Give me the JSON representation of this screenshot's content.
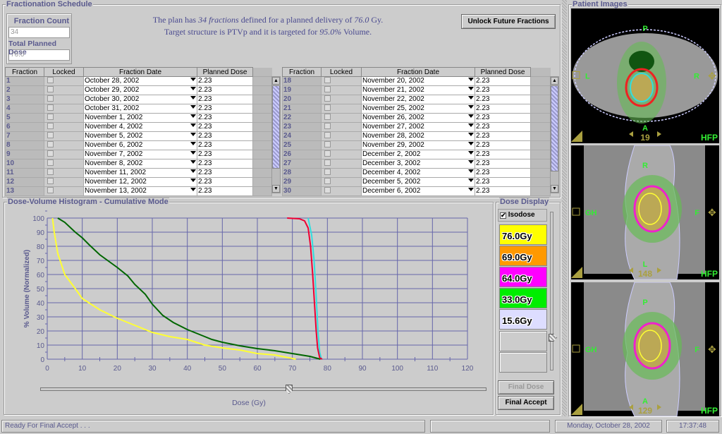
{
  "fractionation": {
    "title": "Fractionation Schedule",
    "fraction_count_label": "Fraction Count",
    "fraction_count_value": "34",
    "total_dose_label": "Total Planned Dose",
    "total_dose_value": "76.0",
    "message": {
      "l1a": "The plan has ",
      "l1b": "34 fractions",
      "l1c": " defined for a planned delivery of ",
      "l1d": "76.0",
      "l1e": " Gy.",
      "l2a": "Target structure is PTVp and it is targeted for ",
      "l2b": "95.0%",
      "l2c": " Volume."
    },
    "unlock_button": "Unlock Future Fractions",
    "columns": [
      "Fraction",
      "Locked",
      "Fraction Date",
      "Planned Dose"
    ],
    "left_rows": [
      [
        "1",
        "October 28, 2002",
        "2.23"
      ],
      [
        "2",
        "October 29, 2002",
        "2.23"
      ],
      [
        "3",
        "October 30, 2002",
        "2.23"
      ],
      [
        "4",
        "October 31, 2002",
        "2.23"
      ],
      [
        "5",
        "November 1, 2002",
        "2.23"
      ],
      [
        "6",
        "November 4, 2002",
        "2.23"
      ],
      [
        "7",
        "November 5, 2002",
        "2.23"
      ],
      [
        "8",
        "November 6, 2002",
        "2.23"
      ],
      [
        "9",
        "November 7, 2002",
        "2.23"
      ],
      [
        "10",
        "November 8, 2002",
        "2.23"
      ],
      [
        "11",
        "November 11, 2002",
        "2.23"
      ],
      [
        "12",
        "November 12, 2002",
        "2.23"
      ],
      [
        "13",
        "November 13, 2002",
        "2.23"
      ]
    ],
    "right_rows": [
      [
        "18",
        "November 20, 2002",
        "2.23"
      ],
      [
        "19",
        "November 21, 2002",
        "2.23"
      ],
      [
        "20",
        "November 22, 2002",
        "2.23"
      ],
      [
        "21",
        "November 25, 2002",
        "2.23"
      ],
      [
        "22",
        "November 26, 2002",
        "2.23"
      ],
      [
        "23",
        "November 27, 2002",
        "2.23"
      ],
      [
        "24",
        "November 28, 2002",
        "2.23"
      ],
      [
        "25",
        "November 29, 2002",
        "2.23"
      ],
      [
        "26",
        "December 2, 2002",
        "2.23"
      ],
      [
        "27",
        "December 3, 2002",
        "2.23"
      ],
      [
        "28",
        "December 4, 2002",
        "2.23"
      ],
      [
        "29",
        "December 5, 2002",
        "2.23"
      ],
      [
        "30",
        "December 6, 2002",
        "2.23"
      ]
    ]
  },
  "dvh": {
    "title": "Dose-Volume Histogram - Cumulative Mode"
  },
  "chart_data": {
    "type": "line",
    "xlabel": "Dose (Gy)",
    "ylabel": "% Volume (Normalized)",
    "xlim": [
      0,
      120
    ],
    "ylim": [
      0,
      100
    ],
    "xticks": [
      0,
      10,
      20,
      30,
      40,
      50,
      60,
      70,
      80,
      90,
      100,
      110,
      120
    ],
    "yticks": [
      0,
      10,
      20,
      30,
      40,
      50,
      60,
      70,
      80,
      90,
      100
    ],
    "grid": true,
    "series": [
      {
        "color": "#ffff33",
        "points": [
          [
            1.5,
            100
          ],
          [
            2,
            90
          ],
          [
            3,
            75
          ],
          [
            5,
            60
          ],
          [
            8,
            50
          ],
          [
            10,
            43
          ],
          [
            15,
            35
          ],
          [
            20,
            29
          ],
          [
            25,
            24
          ],
          [
            30,
            19
          ],
          [
            35,
            16
          ],
          [
            40,
            14
          ],
          [
            45,
            10
          ],
          [
            50,
            8
          ],
          [
            55,
            6.5
          ],
          [
            60,
            4
          ],
          [
            65,
            3
          ],
          [
            68,
            1.5
          ],
          [
            71,
            0
          ]
        ]
      },
      {
        "color": "#006600",
        "points": [
          [
            3,
            100
          ],
          [
            5,
            97
          ],
          [
            8,
            90
          ],
          [
            10,
            86
          ],
          [
            12,
            81
          ],
          [
            15,
            74
          ],
          [
            20,
            65
          ],
          [
            23,
            59
          ],
          [
            25,
            53
          ],
          [
            28,
            46
          ],
          [
            30,
            39
          ],
          [
            33,
            31
          ],
          [
            36,
            26
          ],
          [
            40,
            21
          ],
          [
            45,
            16
          ],
          [
            47,
            14
          ],
          [
            50,
            12
          ],
          [
            55,
            9.5
          ],
          [
            60,
            7.5
          ],
          [
            65,
            6
          ],
          [
            70,
            4
          ],
          [
            75,
            2
          ],
          [
            78,
            0
          ]
        ]
      },
      {
        "color": "#33dddd",
        "points": [
          [
            74.5,
            100
          ],
          [
            75.5,
            88
          ],
          [
            76.2,
            70
          ],
          [
            76.8,
            45
          ],
          [
            77.3,
            20
          ],
          [
            77.8,
            5
          ],
          [
            78.3,
            0
          ]
        ]
      },
      {
        "color": "#ee0033",
        "points": [
          [
            68.5,
            100
          ],
          [
            72,
            99.5
          ],
          [
            73.5,
            98
          ],
          [
            74.5,
            93
          ],
          [
            75.2,
            80
          ],
          [
            75.8,
            60
          ],
          [
            76.3,
            40
          ],
          [
            76.8,
            20
          ],
          [
            77.2,
            8
          ],
          [
            77.8,
            1
          ],
          [
            78.5,
            0
          ]
        ]
      }
    ],
    "slider_value_gy": 76
  },
  "dose_display": {
    "title": "Dose Display",
    "isodose_label": "Isodose",
    "isodose_checked": true,
    "levels": [
      {
        "label": "76.0Gy",
        "color": "#ffff00"
      },
      {
        "label": "69.0Gy",
        "color": "#ff9900"
      },
      {
        "label": "64.0Gy",
        "color": "#ff00ff"
      },
      {
        "label": "33.0Gy",
        "color": "#00ee00"
      },
      {
        "label": "15.6Gy",
        "color": "#ddddff"
      }
    ],
    "final_dose_button": "Final Dose",
    "final_accept_button": "Final Accept"
  },
  "patient_images": {
    "title": "Patient Images",
    "views": [
      {
        "top": "P",
        "bottom": "A",
        "left": "L",
        "right": "R",
        "slice": "19",
        "orientation": "HFP"
      },
      {
        "top": "R",
        "bottom": "L",
        "left": "GH",
        "right": "F",
        "slice": "148",
        "orientation": "HFP"
      },
      {
        "top": "P",
        "bottom": "A",
        "left": "GH",
        "right": "F",
        "slice": "129",
        "orientation": "HFP"
      }
    ]
  },
  "status": {
    "message": "Ready For Final Accept . . .",
    "date": "Monday, October 28, 2002",
    "time": "17:37:48"
  }
}
